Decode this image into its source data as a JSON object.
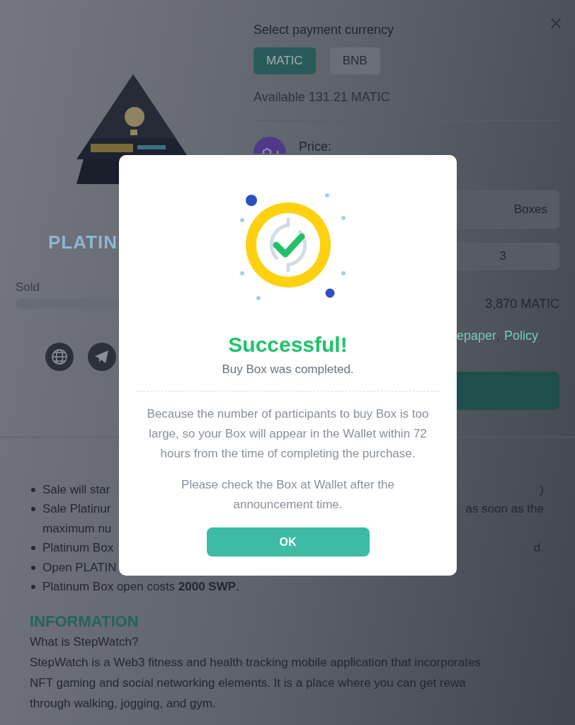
{
  "product": {
    "title": "PLATIN",
    "sold_label": "Sold",
    "links": [
      {
        "kind": "globe"
      },
      {
        "kind": "telegram"
      }
    ]
  },
  "purchase": {
    "currency_label": "Select payment currency",
    "currencies": [
      {
        "label": "MATIC",
        "selected": true
      },
      {
        "label": "BNB",
        "selected": false
      }
    ],
    "available": "Available 131.21 MATIC",
    "price_label": "Price:",
    "unit_field": {
      "value": "Boxes"
    },
    "quantity_field": {
      "value": "3"
    },
    "total": "3,870 MATIC",
    "links": [
      {
        "label": "epaper"
      },
      {
        "label": "Policy"
      }
    ],
    "link_separator": ","
  },
  "rules": [
    {
      "left": "Sale will star",
      "right": ")"
    },
    {
      "left": "Sale Platinur",
      "right": "as soon as the",
      "continuation": "maximum nu"
    },
    {
      "left": "Platinum Box",
      "right": "d."
    },
    {
      "left": "Open PLATIN"
    },
    {
      "left": "Platinum Box open costs **2000 SWP**."
    }
  ],
  "information": {
    "heading": "INFORMATION",
    "question": "What is StepWatch?",
    "lines": [
      "StepWatch is a Web3 fitness and health tracking mobile application that incorporates",
      "NFT gaming and social networking elements. It is a place where you can get rewa",
      "through walking, jogging, and gym."
    ]
  },
  "dialog": {
    "title": "Successful!",
    "subtitle": "Buy Box was completed.",
    "paragraphs": [
      "Because the number of participants to buy Box is too large, so your Box will appear in the Wallet within 72 hours from the time of completing the purchase.",
      "Please check the Box at Wallet after the announcement time."
    ],
    "button": "OK"
  }
}
